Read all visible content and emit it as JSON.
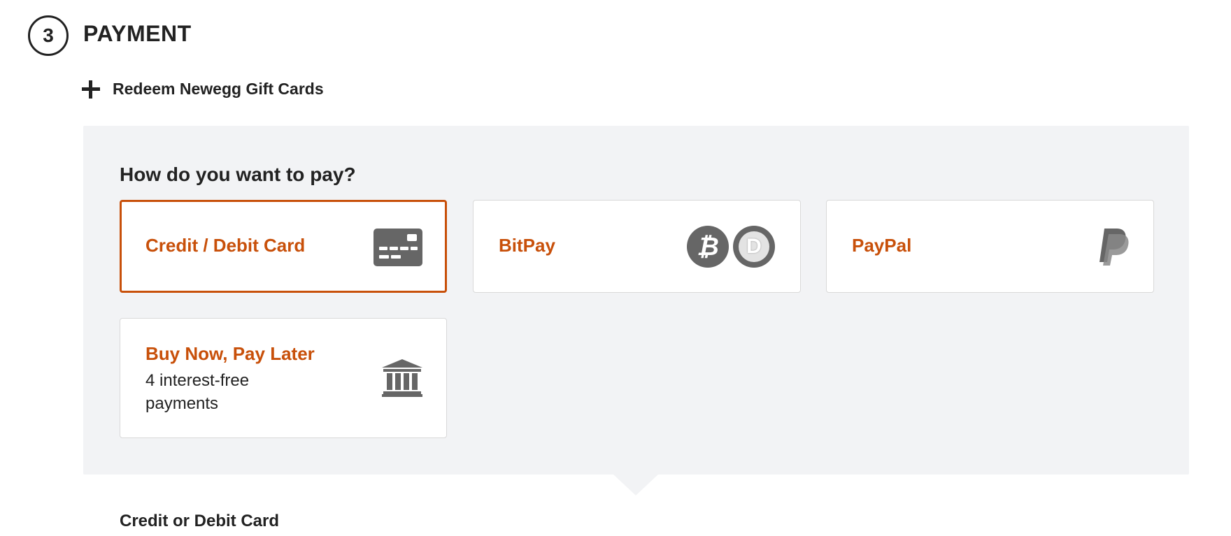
{
  "section": {
    "step_number": "3",
    "title": "PAYMENT"
  },
  "redeem": {
    "label": "Redeem Newegg Gift Cards",
    "icon": "plus-icon"
  },
  "payment_methods": {
    "question": "How do you want to pay?",
    "selected": "credit-debit-card",
    "options": [
      {
        "id": "credit-debit-card",
        "label": "Credit / Debit Card",
        "icon": "credit-card-icon",
        "selected": true
      },
      {
        "id": "bitpay",
        "label": "BitPay",
        "icons": [
          "bitcoin-icon",
          "dogecoin-icon"
        ],
        "selected": false
      },
      {
        "id": "paypal",
        "label": "PayPal",
        "icon": "paypal-icon",
        "selected": false
      },
      {
        "id": "buy-now-pay-later",
        "label": "Buy Now, Pay Later",
        "sublabel": "4 interest-free payments",
        "icon": "bank-icon",
        "selected": false
      }
    ]
  },
  "card_form": {
    "title": "Credit or Debit Card"
  },
  "colors": {
    "accent": "#c8500a",
    "panel_bg": "#f2f3f5",
    "icon_grey": "#666666",
    "text": "#222222"
  }
}
